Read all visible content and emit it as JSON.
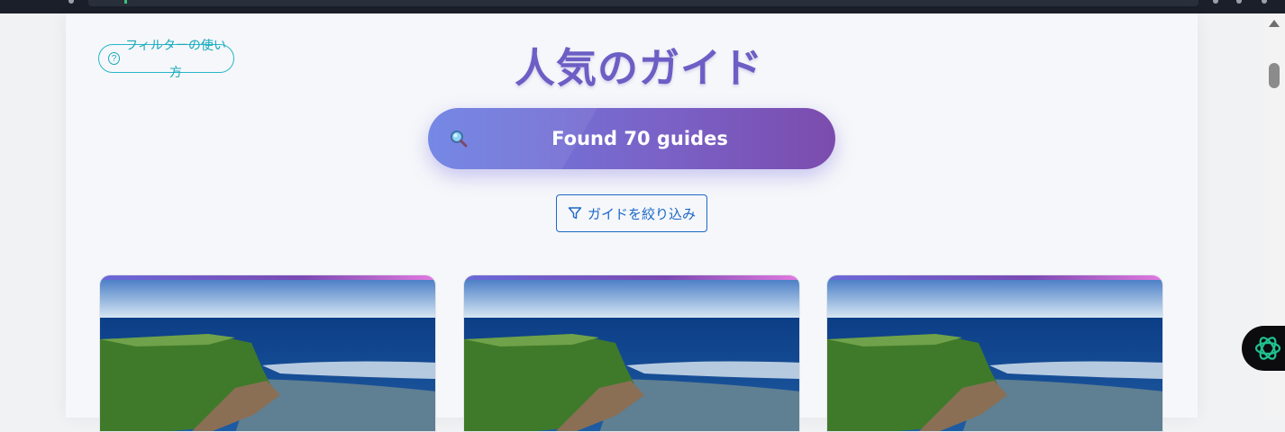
{
  "page": {
    "title": "人気のガイド",
    "help_label": "フィルターの使い方",
    "help_icon": "question-circle-icon",
    "search_summary": "Found 70 guides",
    "search_icon": "magnifier-icon",
    "filter_label": "ガイドを絞り込み",
    "filter_icon": "funnel-icon"
  },
  "guides": [
    {
      "image": "coastal-cliff-photo"
    },
    {
      "image": "coastal-cliff-photo"
    },
    {
      "image": "coastal-cliff-photo"
    }
  ],
  "colors": {
    "title": "#6b5ec4",
    "help_accent": "#1aa9bc",
    "filter_accent": "#1b68c8",
    "pill_start": "#6b7fe3",
    "pill_end": "#7b4cae"
  },
  "assistant": {
    "icon": "assistant-swirl-icon"
  }
}
